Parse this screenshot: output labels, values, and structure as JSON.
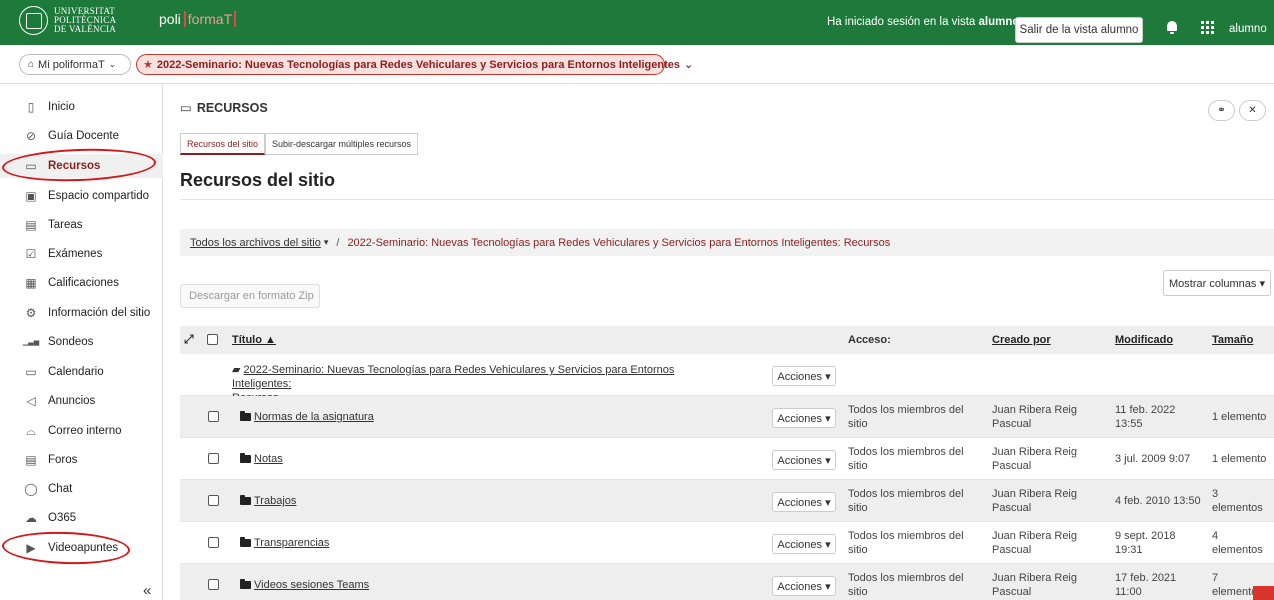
{
  "header": {
    "university": [
      "UNIVERSITAT",
      "POLITÈCNICA",
      "DE VALÈNCIA"
    ],
    "brand_prefix": "poli",
    "brand_suffix": "formaT",
    "session_text": "Ha iniciado sesión en la vista",
    "session_role": "alumno.",
    "exit_button": "Salir de la vista alumno",
    "user": "alumno"
  },
  "sitebar": {
    "my_poliformat": "Mi poliformaT",
    "site_name": "2022-Seminario: Nuevas Tecnologías para Redes Vehiculares y Servicios para Entornos Inteligentes"
  },
  "sidebar": {
    "items": [
      {
        "label": "Inicio",
        "icon": "layout-icon",
        "glyph": "▯"
      },
      {
        "label": "Guía Docente",
        "icon": "compass-icon",
        "glyph": "⊘"
      },
      {
        "label": "Recursos",
        "icon": "folder-icon",
        "glyph": "▭",
        "active": true
      },
      {
        "label": "Espacio compartido",
        "icon": "shared-folder-icon",
        "glyph": "▣"
      },
      {
        "label": "Tareas",
        "icon": "tasks-icon",
        "glyph": "▤"
      },
      {
        "label": "Exámenes",
        "icon": "check-icon",
        "glyph": "☑"
      },
      {
        "label": "Calificaciones",
        "icon": "grades-icon",
        "glyph": "▦"
      },
      {
        "label": "Información del sitio",
        "icon": "gear-icon",
        "glyph": "⚙"
      },
      {
        "label": "Sondeos",
        "icon": "bar-chart-icon",
        "glyph": "▁▃▅"
      },
      {
        "label": "Calendario",
        "icon": "calendar-icon",
        "glyph": "▭"
      },
      {
        "label": "Anuncios",
        "icon": "megaphone-icon",
        "glyph": "◁"
      },
      {
        "label": "Correo interno",
        "icon": "mail-icon",
        "glyph": "⌓"
      },
      {
        "label": "Foros",
        "icon": "forum-icon",
        "glyph": "▤"
      },
      {
        "label": "Chat",
        "icon": "chat-icon",
        "glyph": "◯"
      },
      {
        "label": "O365",
        "icon": "cloud-icon",
        "glyph": "☁"
      },
      {
        "label": "Videoapuntes",
        "icon": "video-icon",
        "glyph": "▶"
      }
    ],
    "collapse": "«"
  },
  "main": {
    "section_title": "RECURSOS",
    "tabs": [
      "Recursos del sitio",
      "Subir-descargar múltiples recursos"
    ],
    "page_heading": "Recursos del sitio",
    "breadcrumb_root": "Todos los archivos del sitio",
    "breadcrumb_caret": "▾",
    "breadcrumb_sep": "/",
    "breadcrumb_current": "2022-Seminario: Nuevas Tecnologías para Redes Vehiculares y Servicios para Entornos Inteligentes: Recursos",
    "show_columns": "Mostrar columnas ▾",
    "zip_button": "Descargar en formato Zip"
  },
  "table": {
    "headers": {
      "title": "Título ▲",
      "access": "Acceso:",
      "created_by": "Creado por",
      "modified": "Modificado",
      "size": "Tamaño"
    },
    "root_row": {
      "title_line1": "2022-Seminario: Nuevas Tecnologías para Redes Vehiculares y Servicios para Entornos Inteligentes:",
      "title_line2": "Recursos",
      "actions": "Acciones ▾"
    },
    "rows": [
      {
        "title": "Normas de la asignatura",
        "actions": "Acciones ▾",
        "access1": "Todos los miembros del",
        "access2": "sitio",
        "creator1": "Juan Ribera Reig",
        "creator2": "Pascual",
        "mod1": "11 feb. 2022",
        "mod2": "13:55",
        "size1": "1 elemento",
        "size2": ""
      },
      {
        "title": "Notas",
        "actions": "Acciones ▾",
        "access1": "Todos los miembros del",
        "access2": "sitio",
        "creator1": "Juan Ribera Reig",
        "creator2": "Pascual",
        "mod1": "3 jul. 2009 9:07",
        "mod2": "",
        "size1": "1 elemento",
        "size2": ""
      },
      {
        "title": "Trabajos",
        "actions": "Acciones ▾",
        "access1": "Todos los miembros del",
        "access2": "sitio",
        "creator1": "Juan Ribera Reig",
        "creator2": "Pascual",
        "mod1": "4 feb. 2010 13:50",
        "mod2": "",
        "size1": "3",
        "size2": "elementos"
      },
      {
        "title": "Transparencias",
        "actions": "Acciones ▾",
        "access1": "Todos los miembros del",
        "access2": "sitio",
        "creator1": "Juan Ribera Reig",
        "creator2": "Pascual",
        "mod1": "9 sept. 2018",
        "mod2": "19:31",
        "size1": "4",
        "size2": "elementos"
      },
      {
        "title": "Videos sesiones Teams",
        "actions": "Acciones ▾",
        "access1": "Todos los miembros del",
        "access2": "sitio",
        "creator1": "Juan Ribera Reig",
        "creator2": "Pascual",
        "mod1": "17 feb. 2021",
        "mod2": "11:00",
        "size1": "7",
        "size2": "elementos"
      }
    ]
  },
  "colors": {
    "header_green": "#1d7a3a",
    "accent_red": "#8b1e1e",
    "annotation_red": "#d11919"
  }
}
